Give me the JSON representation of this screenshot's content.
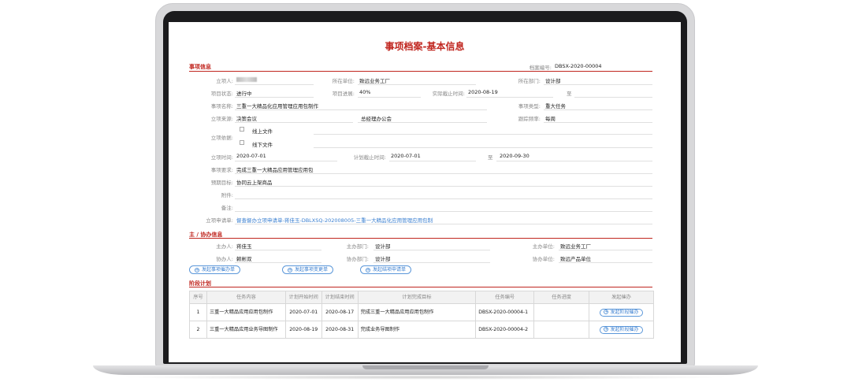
{
  "page": {
    "title": "事项档案-基本信息",
    "archive_label": "档案编号:",
    "archive_no": "DBSX-2020-00004"
  },
  "item_info": {
    "section_title": "事项信息",
    "creator_label": "立项人:",
    "unit_label": "所在单位:",
    "unit_value": "致远业务工厂",
    "dept_label": "所在部门:",
    "dept_value": "设计部",
    "status_label": "项目状态:",
    "status_value": "进行中",
    "progress_label": "项目进展:",
    "progress_value": "40%",
    "actual_end_label": "实际截止时间:",
    "actual_end_value": "2020-08-19",
    "to_label": "至",
    "name_label": "事项名称:",
    "name_value": "三重一大精品化应用管理应用包制作",
    "type_label": "事项类型:",
    "type_value": "重大任务",
    "source_label": "立项来源:",
    "source_value": "决策会议",
    "source_extra": "总经理办公会",
    "freq_label": "跟踪频率:",
    "freq_value": "每周",
    "basis_label": "立项依据:",
    "basis_opt1": "线上文件",
    "basis_opt2": "线下文件",
    "start_label": "立项时间:",
    "start_value": "2020-07-01",
    "plan_end_label": "计划截止时间:",
    "plan_end_value": "2020-07-01",
    "to_label2": "至",
    "plan_end_value2": "2020-09-30",
    "req_label": "事项要求:",
    "req_value": "完成三重一大精品应用管理应用包",
    "goal_label": "预期目标:",
    "goal_value": "协同云上架商品",
    "attach_label": "附件:",
    "remark_label": "备注:",
    "apply_label": "立项申请单:",
    "apply_value": "督查督办立项申请单-蒋佳玉-DBLXSQ-202008005-三重一大精品化应用管理应用包制"
  },
  "co_info": {
    "section_title": "主 / 协办信息",
    "main_person_label": "主办人:",
    "main_person_value": "蒋佳玉",
    "main_dept_label": "主办部门:",
    "main_dept_value": "设计部",
    "main_unit_label": "主办单位:",
    "main_unit_value": "致远业务工厂",
    "co_person_label": "协办人:",
    "co_person_value": "赖彬双",
    "co_dept_label": "协办部门:",
    "co_dept_value": "设计部",
    "co_unit_label": "协办单位:",
    "co_unit_value": "致远产品单位",
    "btn_urge": "发起事项催办单",
    "btn_change": "发起事项变更单",
    "btn_close": "发起结项申请单"
  },
  "plan": {
    "section_title": "阶段计划",
    "headers": [
      "序号",
      "任务内容",
      "计划开始时间",
      "计划结束时间",
      "计划完成目标",
      "任务编号",
      "任务进度",
      "发起催办"
    ],
    "rows": [
      {
        "no": "1",
        "content": "三重一大精品应用应用包制作",
        "start": "2020-07-01",
        "end": "2020-08-17",
        "goal": "完成三重一大精品应用应用包制作",
        "code": "DBSX-2020-00004-1",
        "progress": "",
        "action": "发起阶段催办"
      },
      {
        "no": "2",
        "content": "三重一大精品应用业务导图制作",
        "start": "2020-08-19",
        "end": "2020-08-31",
        "goal": "完成业务导图制作",
        "code": "DBSX-2020-00004-2",
        "progress": "",
        "action": "发起阶段催办"
      }
    ]
  }
}
